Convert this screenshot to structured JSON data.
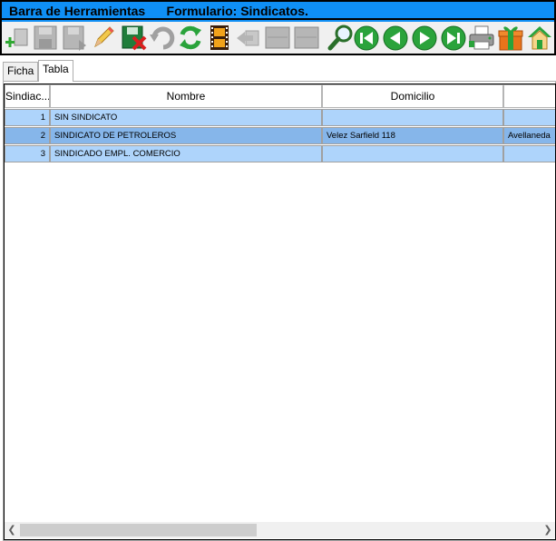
{
  "toolbar": {
    "title": "Barra de Herramientas      Formulario: Sindicatos.",
    "buttons": [
      {
        "icon": "add-icon"
      },
      {
        "icon": "save-disabled-icon"
      },
      {
        "icon": "save-as-disabled-icon"
      },
      {
        "icon": "edit-pencil-icon"
      },
      {
        "icon": "delete-record-icon"
      },
      {
        "icon": "undo-disabled-icon"
      },
      {
        "icon": "refresh-icon"
      },
      {
        "icon": "film-icon"
      },
      {
        "icon": "back-disabled-icon"
      },
      {
        "icon": "disabled-box-icon"
      },
      {
        "icon": "disabled-box-icon"
      },
      {
        "icon": "search-icon"
      },
      {
        "icon": "first-record-icon"
      },
      {
        "icon": "previous-record-icon"
      },
      {
        "icon": "next-record-icon"
      },
      {
        "icon": "last-record-icon"
      },
      {
        "icon": "printer-icon"
      },
      {
        "icon": "gift-icon"
      },
      {
        "icon": "home-icon"
      }
    ]
  },
  "tabs": [
    {
      "label": "Ficha",
      "active": false
    },
    {
      "label": "Tabla",
      "active": true
    }
  ],
  "grid": {
    "columns": [
      "Sindiac...",
      "Nombre",
      "Domicilio",
      ""
    ],
    "rows": [
      {
        "id": "1",
        "nombre": "SIN SINDICATO",
        "domicilio": "",
        "localidad": ""
      },
      {
        "id": "2",
        "nombre": "SINDICATO DE PETROLEROS",
        "domicilio": "Velez Sarfield 118",
        "localidad": "Avellaneda"
      },
      {
        "id": "3",
        "nombre": "SINDICADO EMPL. COMERCIO",
        "domicilio": "",
        "localidad": ""
      }
    ],
    "selected_row": 1
  },
  "colors": {
    "title_bar": "#0f8ff5",
    "row": "#aed4fb",
    "row_selected": "#86b6ea"
  }
}
